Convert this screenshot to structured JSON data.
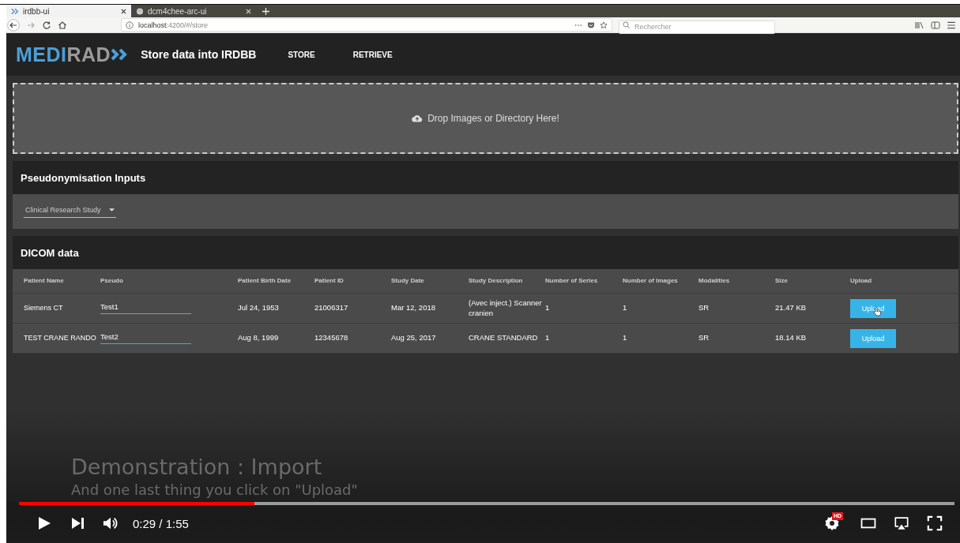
{
  "browser": {
    "tabs": [
      {
        "title": "irdbb-ui",
        "selected": true
      },
      {
        "title": "dcm4chee-arc-ui",
        "selected": false
      }
    ],
    "url": {
      "host": "localhost",
      "path": ":4200/#/store"
    },
    "search": {
      "placeholder": "Rechercher"
    }
  },
  "app": {
    "logo": {
      "part_1": "MEDI",
      "part_2": "RAD"
    },
    "title": "Store data into IRDBB",
    "nav": [
      {
        "label": "STORE"
      },
      {
        "label": "RETRIEVE"
      }
    ]
  },
  "dropzone": {
    "text": "Drop Images or Directory Here!"
  },
  "pseudonymisation": {
    "title": "Pseudonymisation Inputs",
    "select": {
      "value": "Clinical Research Study"
    }
  },
  "dicom": {
    "title": "DICOM data",
    "columns": [
      "Patient Name",
      "Pseudo",
      "Patient Birth Date",
      "Patient ID",
      "Study Date",
      "Study Description",
      "Number of Series",
      "Number of Images",
      "Modalities",
      "Size",
      "Upload"
    ],
    "rows": [
      {
        "name": "Siemens CT",
        "pseudo": "Test1",
        "focused": false,
        "birth": "Jul 24, 1953",
        "id": "21006317",
        "study_date": "Mar 12, 2018",
        "description": "(Avec inject.) Scanner cranien",
        "series": "1",
        "images": "1",
        "modality": "SR",
        "size": "21.47 KB",
        "button": "Upload"
      },
      {
        "name": "TEST CRANE RANDO",
        "pseudo": "Test2",
        "focused": true,
        "birth": "Aug 8, 1999",
        "id": "12345678",
        "study_date": "Aug 25, 2017",
        "description": "CRANE STANDARD",
        "series": "1",
        "images": "1",
        "modality": "SR",
        "size": "18.14 KB",
        "button": "Upload"
      }
    ]
  },
  "video": {
    "caption_title": "Demonstration : Import",
    "caption_subtitle": "And one last thing you click on \"Upload\"",
    "progress": {
      "level": 0.252
    },
    "time": "0:29 / 1:55",
    "hd_badge": "HD"
  }
}
